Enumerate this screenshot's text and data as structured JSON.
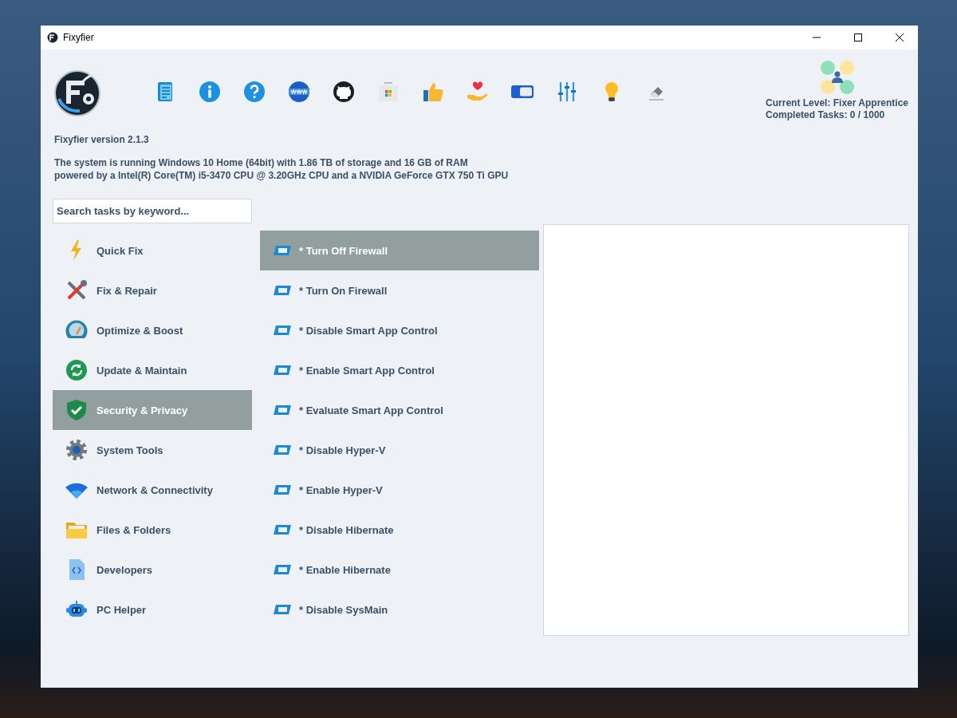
{
  "window": {
    "title": "Fixyfier"
  },
  "level": {
    "current": "Current Level: Fixer Apprentice",
    "completed": "Completed Tasks: 0 / 1000"
  },
  "version": "Fixyfier version 2.1.3",
  "system_info": [
    "The system is running Windows 10 Home (64bit) with 1.86 TB of storage and 16 GB of RAM",
    "powered by a Intel(R) Core(TM) i5-3470 CPU @ 3.20GHz CPU and a NVIDIA GeForce GTX 750 Ti GPU"
  ],
  "search": {
    "placeholder": "Search tasks by keyword..."
  },
  "categories": [
    {
      "label": "Quick Fix",
      "selected": false
    },
    {
      "label": "Fix & Repair",
      "selected": false
    },
    {
      "label": "Optimize & Boost",
      "selected": false
    },
    {
      "label": "Update & Maintain",
      "selected": false
    },
    {
      "label": "Security & Privacy",
      "selected": true
    },
    {
      "label": "System Tools",
      "selected": false
    },
    {
      "label": "Network & Connectivity",
      "selected": false
    },
    {
      "label": "Files & Folders",
      "selected": false
    },
    {
      "label": "Developers",
      "selected": false
    },
    {
      "label": "PC Helper",
      "selected": false
    }
  ],
  "tasks": [
    {
      "label": "* Turn Off Firewall",
      "selected": true
    },
    {
      "label": "* Turn On Firewall",
      "selected": false
    },
    {
      "label": "* Disable Smart App Control",
      "selected": false
    },
    {
      "label": "* Enable Smart App Control",
      "selected": false
    },
    {
      "label": "* Evaluate Smart App Control",
      "selected": false
    },
    {
      "label": "* Disable Hyper-V",
      "selected": false
    },
    {
      "label": "* Enable Hyper-V",
      "selected": false
    },
    {
      "label": "* Disable Hibernate",
      "selected": false
    },
    {
      "label": "* Enable Hibernate",
      "selected": false
    },
    {
      "label": "* Disable SysMain",
      "selected": false
    }
  ]
}
